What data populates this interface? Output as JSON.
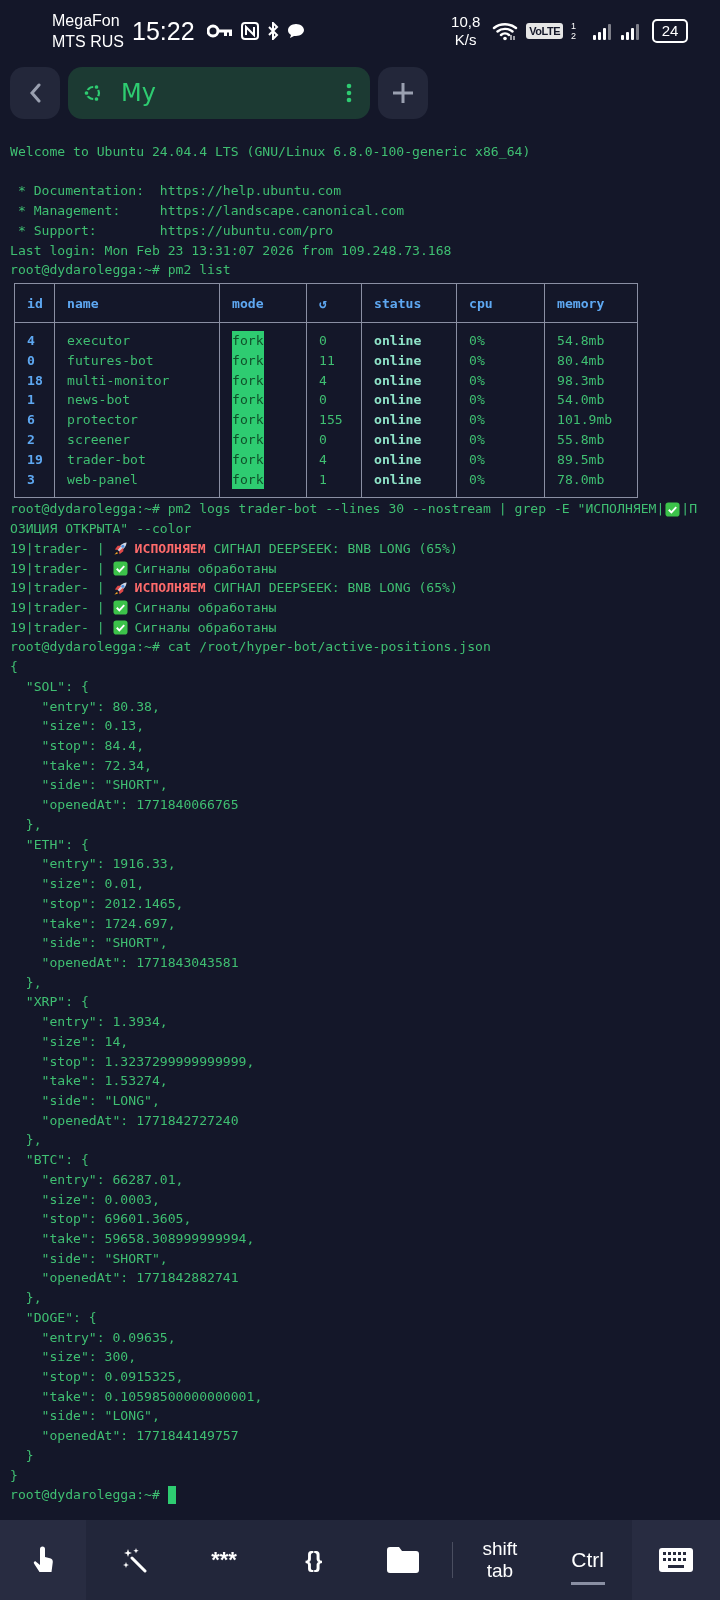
{
  "status_bar": {
    "carriers": [
      "MegaFon",
      "MTS RUS"
    ],
    "time": "15:22",
    "speed": [
      "10,8",
      "K/s"
    ],
    "volte": "VoLTE",
    "sim_slots": [
      "1",
      "2"
    ],
    "battery": "24"
  },
  "tab_bar": {
    "session": {
      "title": "My",
      "selected": true
    }
  },
  "terminal": {
    "lines": [
      {
        "kind": "text",
        "text": "Welcome to Ubuntu 24.04.4 LTS (GNU/Linux 6.8.0-100-generic x86_64)"
      },
      {
        "kind": "blank"
      },
      {
        "kind": "text",
        "text": " * Documentation:  https://help.ubuntu.com"
      },
      {
        "kind": "text",
        "text": " * Management:     https://landscape.canonical.com"
      },
      {
        "kind": "text",
        "text": " * Support:        https://ubuntu.com/pro"
      },
      {
        "kind": "text",
        "text": "Last login: Mon Feb 23 13:31:07 2026 from 109.248.73.168"
      },
      {
        "kind": "prompt",
        "text": "root@dydarolegga:~# pm2 list"
      },
      {
        "kind": "table",
        "columns": [
          "id",
          "name",
          "mode",
          "↺",
          "status",
          "cpu",
          "memory"
        ],
        "rows": [
          {
            "id": "4",
            "name": "executor",
            "mode": "fork",
            "restarts": "0",
            "status": "online",
            "cpu": "0%",
            "memory": "54.8mb"
          },
          {
            "id": "0",
            "name": "futures-bot",
            "mode": "fork",
            "restarts": "11",
            "status": "online",
            "cpu": "0%",
            "memory": "80.4mb"
          },
          {
            "id": "18",
            "name": "multi-monitor",
            "mode": "fork",
            "restarts": "4",
            "status": "online",
            "cpu": "0%",
            "memory": "98.3mb"
          },
          {
            "id": "1",
            "name": "news-bot",
            "mode": "fork",
            "restarts": "0",
            "status": "online",
            "cpu": "0%",
            "memory": "54.0mb"
          },
          {
            "id": "6",
            "name": "protector",
            "mode": "fork",
            "restarts": "155",
            "status": "online",
            "cpu": "0%",
            "memory": "101.9mb"
          },
          {
            "id": "2",
            "name": "screener",
            "mode": "fork",
            "restarts": "0",
            "status": "online",
            "cpu": "0%",
            "memory": "55.8mb"
          },
          {
            "id": "19",
            "name": "trader-bot",
            "mode": "fork",
            "restarts": "4",
            "status": "online",
            "cpu": "0%",
            "memory": "89.5mb"
          },
          {
            "id": "3",
            "name": "web-panel",
            "mode": "fork",
            "restarts": "1",
            "status": "online",
            "cpu": "0%",
            "memory": "78.0mb"
          }
        ]
      },
      {
        "kind": "prompt_parts",
        "parts": [
          "root@dydarolegga:~# pm2 logs trader-bot --lines 30 --nostream | grep -E \"ИСПОЛНЯЕМ|",
          "|П"
        ]
      },
      {
        "kind": "text",
        "text": "ОЗИЦИЯ ОТКРЫТА\" --color"
      },
      {
        "kind": "signal_log",
        "source": "19|trader- |",
        "message": "**ИСПОЛНЯЕМ** СИГНАЛ DEEPSEEK: BNB LONG (65%)"
      },
      {
        "kind": "done_log",
        "source": "19|trader- |",
        "message": "Сигналы обработаны"
      },
      {
        "kind": "signal_log",
        "source": "19|trader- |",
        "message": "**ИСПОЛНЯЕМ** СИГНАЛ DEEPSEEK: BNB LONG (65%)"
      },
      {
        "kind": "done_log",
        "source": "19|trader- |",
        "message": "Сигналы обработаны"
      },
      {
        "kind": "done_log",
        "source": "19|trader- |",
        "message": "Сигналы обработаны"
      },
      {
        "kind": "prompt",
        "text": "root@dydarolegga:~# cat /root/hyper-bot/active-positions.json"
      },
      {
        "kind": "text",
        "text": "{"
      },
      {
        "kind": "text",
        "text": "  \"SOL\": {"
      },
      {
        "kind": "text",
        "text": "    \"entry\": 80.38,"
      },
      {
        "kind": "text",
        "text": "    \"size\": 0.13,"
      },
      {
        "kind": "text",
        "text": "    \"stop\": 84.4,"
      },
      {
        "kind": "text",
        "text": "    \"take\": 72.34,"
      },
      {
        "kind": "text",
        "text": "    \"side\": \"SHORT\","
      },
      {
        "kind": "text",
        "text": "    \"openedAt\": 1771840066765"
      },
      {
        "kind": "text",
        "text": "  },"
      },
      {
        "kind": "text",
        "text": "  \"ETH\": {"
      },
      {
        "kind": "text",
        "text": "    \"entry\": 1916.33,"
      },
      {
        "kind": "text",
        "text": "    \"size\": 0.01,"
      },
      {
        "kind": "text",
        "text": "    \"stop\": 2012.1465,"
      },
      {
        "kind": "text",
        "text": "    \"take\": 1724.697,"
      },
      {
        "kind": "text",
        "text": "    \"side\": \"SHORT\","
      },
      {
        "kind": "text",
        "text": "    \"openedAt\": 1771843043581"
      },
      {
        "kind": "text",
        "text": "  },"
      },
      {
        "kind": "text",
        "text": "  \"XRP\": {"
      },
      {
        "kind": "text",
        "text": "    \"entry\": 1.3934,"
      },
      {
        "kind": "text",
        "text": "    \"size\": 14,"
      },
      {
        "kind": "text",
        "text": "    \"stop\": 1.3237299999999999,"
      },
      {
        "kind": "text",
        "text": "    \"take\": 1.53274,"
      },
      {
        "kind": "text",
        "text": "    \"side\": \"LONG\","
      },
      {
        "kind": "text",
        "text": "    \"openedAt\": 1771842727240"
      },
      {
        "kind": "text",
        "text": "  },"
      },
      {
        "kind": "text",
        "text": "  \"BTC\": {"
      },
      {
        "kind": "text",
        "text": "    \"entry\": 66287.01,"
      },
      {
        "kind": "text",
        "text": "    \"size\": 0.0003,"
      },
      {
        "kind": "text",
        "text": "    \"stop\": 69601.3605,"
      },
      {
        "kind": "text",
        "text": "    \"take\": 59658.308999999994,"
      },
      {
        "kind": "text",
        "text": "    \"side\": \"SHORT\","
      },
      {
        "kind": "text",
        "text": "    \"openedAt\": 1771842882741"
      },
      {
        "kind": "text",
        "text": "  },"
      },
      {
        "kind": "text",
        "text": "  \"DOGE\": {"
      },
      {
        "kind": "text",
        "text": "    \"entry\": 0.09635,"
      },
      {
        "kind": "text",
        "text": "    \"size\": 300,"
      },
      {
        "kind": "text",
        "text": "    \"stop\": 0.0915325,"
      },
      {
        "kind": "text",
        "text": "    \"take\": 0.10598500000000001,"
      },
      {
        "kind": "text",
        "text": "    \"side\": \"LONG\","
      },
      {
        "kind": "text",
        "text": "    \"openedAt\": 1771844149757"
      },
      {
        "kind": "text",
        "text": "  }"
      },
      {
        "kind": "text",
        "text": "}"
      },
      {
        "kind": "prompt",
        "text": "root@dydarolegga:~#",
        "cursor": true
      }
    ]
  },
  "toolbar": {
    "keys": [
      {
        "kind": "touch"
      },
      {
        "kind": "magic"
      },
      {
        "kind": "label",
        "label": "***"
      },
      {
        "kind": "label",
        "label": "{}"
      },
      {
        "kind": "folder"
      },
      {
        "kind": "divider"
      },
      {
        "kind": "label",
        "label": "shift tab"
      },
      {
        "kind": "modifier",
        "label": "Ctrl"
      },
      {
        "kind": "keyboard"
      }
    ]
  }
}
